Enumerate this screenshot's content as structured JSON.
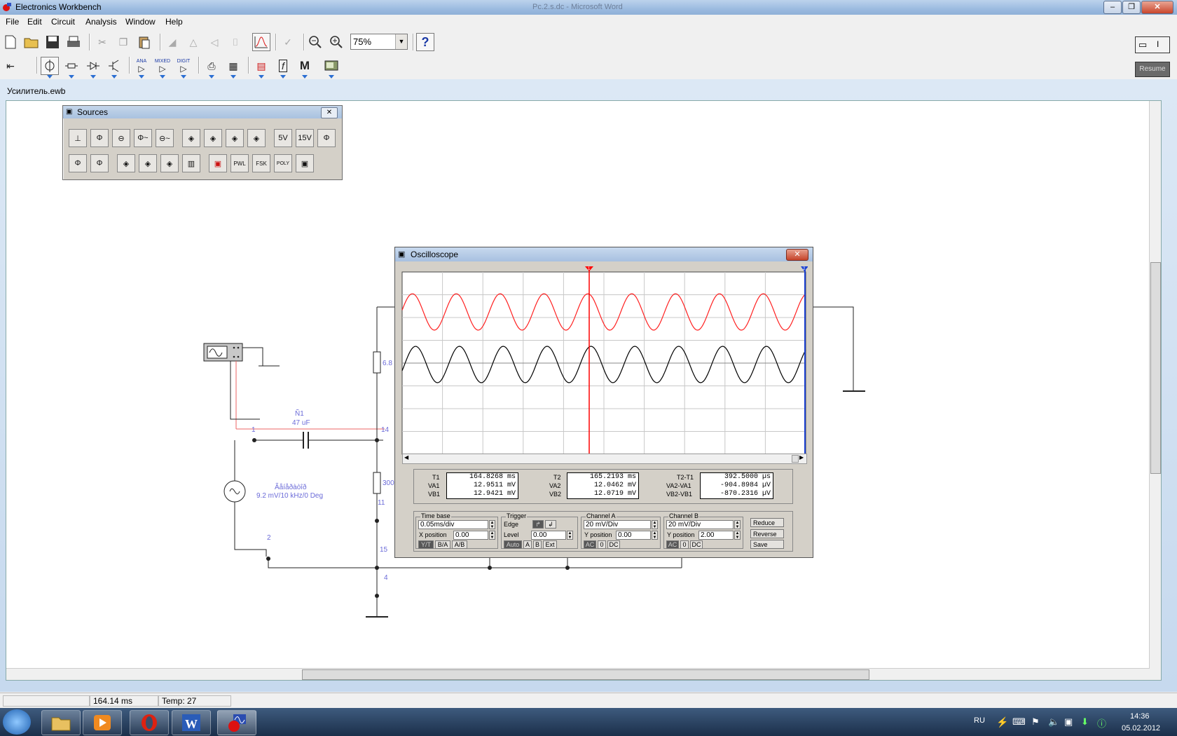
{
  "window": {
    "title": "Electronics Workbench",
    "background_title": "Рс.2.s.dc - Microsoft Word"
  },
  "menu": [
    "File",
    "Edit",
    "Circuit",
    "Analysis",
    "Window",
    "Help"
  ],
  "toolbar": {
    "zoom_value": "75%",
    "help_label": "?",
    "resume_label": "Resume",
    "power_label": "I"
  },
  "parts_bin": {
    "ana": "ANA",
    "mixed": "MIXED",
    "digit": "DIGIT",
    "misc_label": "M"
  },
  "document": {
    "title": "Усилитель.ewb"
  },
  "sources_panel": {
    "title": "Sources",
    "row2_labels": {
      "pwl": "PWL",
      "fsk": "FSK",
      "poly": "POLY"
    },
    "row1_labels": {
      "five_v": "5V",
      "fifteen_v": "15V"
    }
  },
  "schematic": {
    "cap_name": "Ñ1",
    "cap_value": "47 uF",
    "source_name": "Ãåíåðàòîð",
    "source_value": "9.2 mV/10 kHz/0 Deg",
    "r1_value": "6.8",
    "r2_value": "300",
    "nodes": {
      "n1": "1",
      "n2": "2",
      "n14": "14",
      "n11": "11",
      "n15": "15",
      "n4": "4"
    }
  },
  "oscilloscope": {
    "title": "Oscilloscope",
    "readouts": {
      "t1_label": "T1",
      "t1": "164.8268 ms",
      "va1_label": "VA1",
      "va1": "12.9511 mV",
      "vb1_label": "VB1",
      "vb1": "12.9421 mV",
      "t2_label": "T2",
      "t2": "165.2193 ms",
      "va2_label": "VA2",
      "va2": "12.0462 mV",
      "vb2_label": "VB2",
      "vb2": "12.0719 mV",
      "dt_label": "T2-T1",
      "dt": "392.5000 µs",
      "dva_label": "VA2-VA1",
      "dva": "-904.8984 µV",
      "dvb_label": "VB2-VB1",
      "dvb": "-870.2316 µV"
    },
    "timebase": {
      "title": "Time base",
      "value": "0.05ms/div",
      "xpos_label": "X position",
      "xpos": "0.00",
      "yt": "Y/T",
      "ba": "B/A",
      "ab": "A/B"
    },
    "trigger": {
      "title": "Trigger",
      "edge_label": "Edge",
      "level_label": "Level",
      "level": "0.00",
      "auto": "Auto",
      "a": "A",
      "b": "B",
      "ext": "Ext"
    },
    "channel_a": {
      "title": "Channel A",
      "value": "20 mV/Div",
      "ypos_label": "Y position",
      "ypos": "0.00",
      "ac": "AC",
      "zero": "0",
      "dc": "DC"
    },
    "channel_b": {
      "title": "Channel B",
      "value": "20 mV/Div",
      "ypos_label": "Y position",
      "ypos": "2.00",
      "ac": "AC",
      "zero": "0",
      "dc": "DC"
    },
    "buttons": {
      "reduce": "Reduce",
      "reverse": "Reverse",
      "save": "Save"
    },
    "cursor1": "1",
    "cursor2": "2",
    "colors": {
      "channel_a": "#ff2020",
      "channel_b": "#000000",
      "cursor1": "#ff0000",
      "cursor2": "#1a3fd0"
    }
  },
  "status": {
    "time": "164.14 ms",
    "temp": "Temp:  27"
  },
  "taskbar": {
    "lang": "RU",
    "time": "14:36",
    "date": "05.02.2012"
  }
}
